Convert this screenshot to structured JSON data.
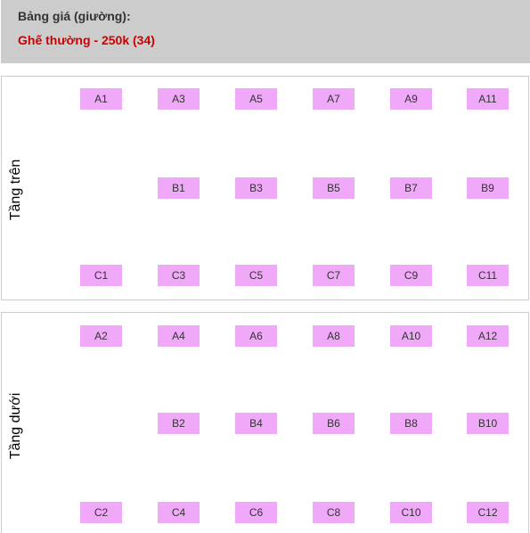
{
  "price_panel": {
    "title": "Bảng giá (giường):",
    "items": [
      {
        "label": "Ghế thường - 250k (34)",
        "color": "#cc0000"
      }
    ]
  },
  "seat_color": "#f0a8f8",
  "decks": [
    {
      "label": "Tầng trên",
      "rows": [
        [
          "A1",
          "A3",
          "A5",
          "A7",
          "A9",
          "A11"
        ],
        [
          "",
          "B1",
          "B3",
          "B5",
          "B7",
          "B9"
        ],
        [
          "C1",
          "C3",
          "C5",
          "C7",
          "C9",
          "C11"
        ]
      ]
    },
    {
      "label": "Tầng dưới",
      "rows": [
        [
          "A2",
          "A4",
          "A6",
          "A8",
          "A10",
          "A12"
        ],
        [
          "",
          "B2",
          "B4",
          "B6",
          "B8",
          "B10"
        ],
        [
          "C2",
          "C4",
          "C6",
          "C8",
          "C10",
          "C12"
        ]
      ]
    }
  ]
}
